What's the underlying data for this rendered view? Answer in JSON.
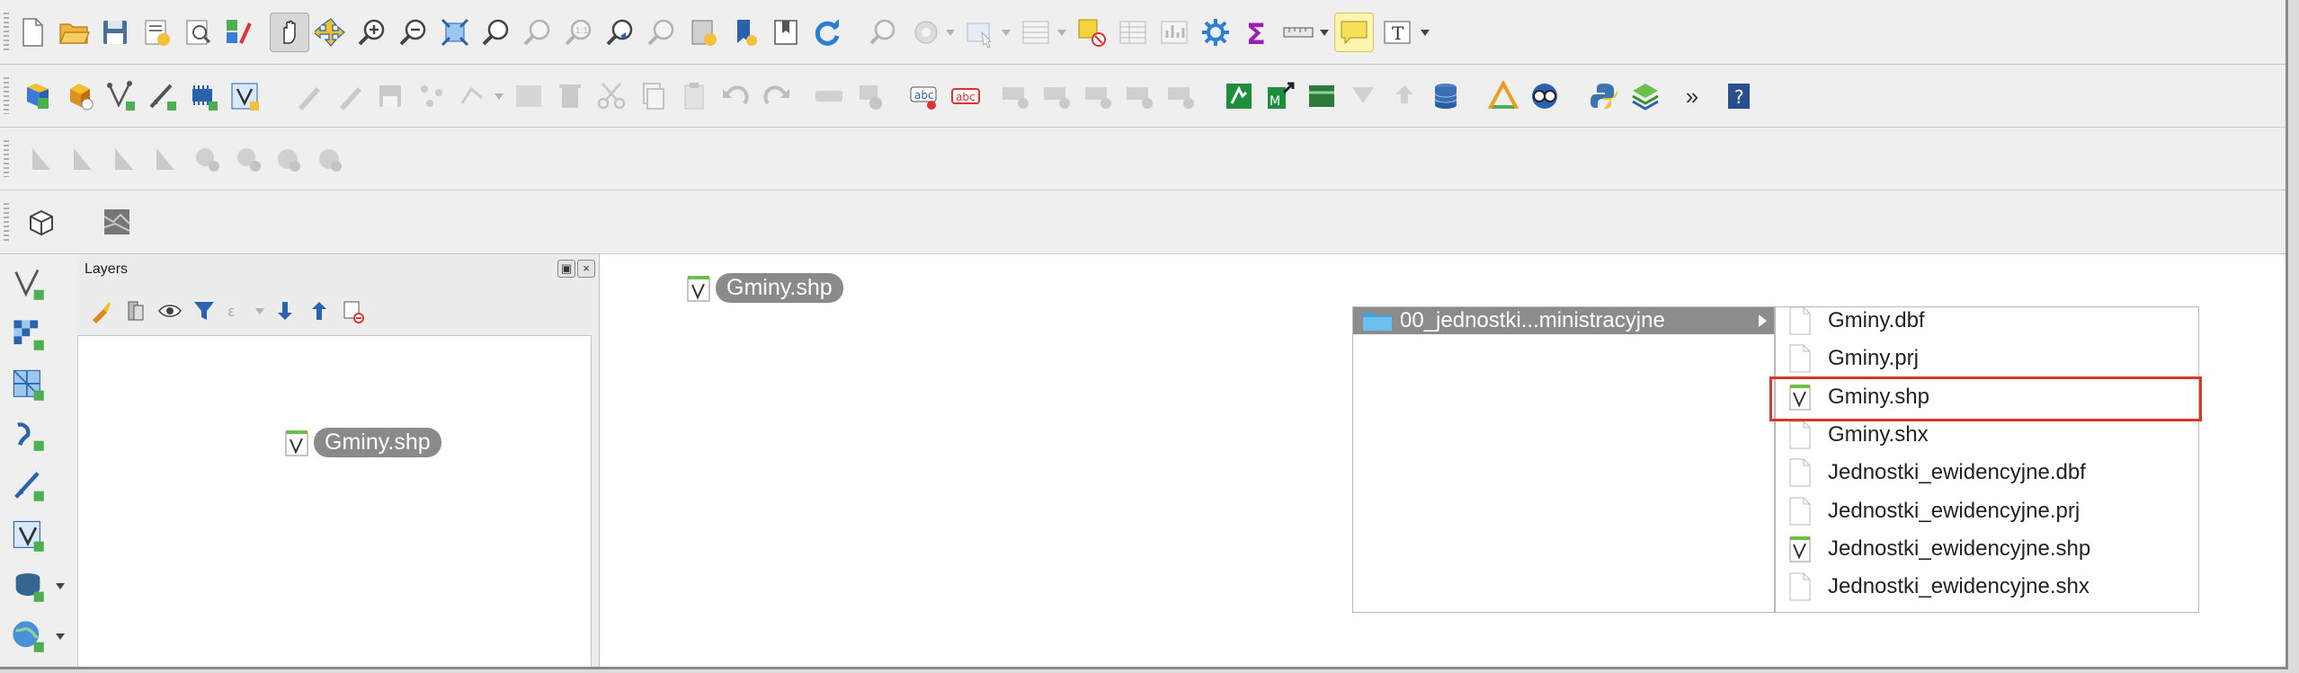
{
  "layers_panel": {
    "title": "Layers",
    "float_button": "▣",
    "close_button": "×",
    "dragged_layer": "Gminy.shp"
  },
  "canvas": {
    "dragged_layer": "Gminy.shp"
  },
  "file_browser": {
    "folder": "00_jednostki...ministracyjne",
    "files": [
      {
        "name": "Gminy.dbf",
        "type": "doc"
      },
      {
        "name": "Gminy.prj",
        "type": "doc"
      },
      {
        "name": "Gminy.shp",
        "type": "shp"
      },
      {
        "name": "Gminy.shx",
        "type": "doc"
      },
      {
        "name": "Jednostki_ewidencyjne.dbf",
        "type": "doc"
      },
      {
        "name": "Jednostki_ewidencyjne.prj",
        "type": "doc"
      },
      {
        "name": "Jednostki_ewidencyjne.shp",
        "type": "shp"
      },
      {
        "name": "Jednostki_ewidencyjne.shx",
        "type": "doc"
      }
    ],
    "highlighted_file": "Gminy.shp"
  },
  "toolbar_more": "»",
  "colors": {
    "highlight_box": "#d9372b",
    "selection_gray": "#8c8c8c",
    "folder_blue": "#3fa3e0"
  }
}
